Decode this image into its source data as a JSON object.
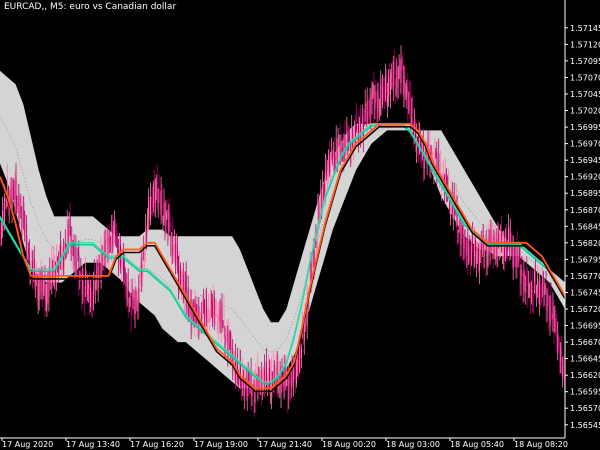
{
  "title": "EURCAD,, M5:  euro vs Canadian dollar",
  "colors": {
    "background": "#000000",
    "axis": "#ffffff",
    "band_fill": "#e6e6e6",
    "band_mid": "#8a8a8a",
    "bull_candle": "#ff7aa8",
    "bear_candle": "#b0006a",
    "orange_line": "#ff5a1a",
    "dark_line": "#1a0500",
    "green_line": "#3dd9a0",
    "teal_line": "#00c8a0"
  },
  "chart_data": {
    "type": "candlestick",
    "title": "EURCAD,, M5:  euro vs Canadian dollar",
    "ylim": [
      1.56525,
      1.57175
    ],
    "y_ticks": [
      "1.57145",
      "1.57120",
      "1.57095",
      "1.57070",
      "1.57045",
      "1.57020",
      "1.56995",
      "1.56970",
      "1.56945",
      "1.56920",
      "1.56895",
      "1.56870",
      "1.56845",
      "1.56820",
      "1.56795",
      "1.56770",
      "1.56745",
      "1.56720",
      "1.56695",
      "1.56670",
      "1.56645",
      "1.56620",
      "1.56595",
      "1.56570",
      "1.56545"
    ],
    "x_ticks": [
      "17 Aug 2020",
      "17 Aug 13:40",
      "17 Aug 16:20",
      "17 Aug 19:00",
      "17 Aug 21:40",
      "18 Aug 00:20",
      "18 Aug 03:00",
      "18 Aug 05:40",
      "18 Aug 08:20"
    ],
    "grid": false,
    "series": [
      {
        "kind": "price",
        "values": [
          1.5683,
          1.569,
          1.5692,
          1.5688,
          1.5679,
          1.5674,
          1.5672,
          1.5676,
          1.568,
          1.5686,
          1.5681,
          1.5676,
          1.5673,
          1.5676,
          1.568,
          1.5683,
          1.5679,
          1.5675,
          1.5676,
          1.5684,
          1.5688,
          1.5685,
          1.5683,
          1.568,
          1.5677,
          1.5673,
          1.5671,
          1.567,
          1.5669,
          1.5668,
          1.5666,
          1.5664,
          1.5663,
          1.5661,
          1.566,
          1.5659,
          1.566,
          1.5661,
          1.5664,
          1.5669,
          1.5676,
          1.5683,
          1.5689,
          1.5693,
          1.5696,
          1.5699,
          1.5701,
          1.5702,
          1.5703,
          1.5701,
          1.5703,
          1.5706,
          1.5709,
          1.5705,
          1.5699,
          1.5695,
          1.5693,
          1.569,
          1.5688,
          1.5687,
          1.5684,
          1.5683,
          1.5681,
          1.568,
          1.5679,
          1.568,
          1.5682,
          1.5681,
          1.5678,
          1.5676,
          1.5674,
          1.567,
          1.5666,
          1.566
        ]
      },
      {
        "kind": "band_upper",
        "values": [
          1.5708,
          1.5707,
          1.5706,
          1.5703,
          1.5698,
          1.5693,
          1.5689,
          1.5686,
          1.5686,
          1.5686,
          1.5686,
          1.5686,
          1.5686,
          1.5685,
          1.5684,
          1.5683,
          1.5683,
          1.5683,
          1.5683,
          1.5684,
          1.5684,
          1.5684,
          1.5683,
          1.5683,
          1.5683,
          1.5683,
          1.5683,
          1.5683,
          1.5683,
          1.5683,
          1.5683,
          1.5681,
          1.5678,
          1.5675,
          1.5672,
          1.567,
          1.567,
          1.5672,
          1.5676,
          1.568,
          1.5684,
          1.5688,
          1.5692,
          1.5695,
          1.5697,
          1.5699,
          1.57,
          1.57,
          1.57,
          1.57,
          1.57,
          1.57,
          1.57,
          1.57,
          1.5699,
          1.5699,
          1.5699,
          1.5699,
          1.5697,
          1.5695,
          1.5693,
          1.5691,
          1.5689,
          1.5687,
          1.5685,
          1.5683,
          1.5682,
          1.5682,
          1.5681,
          1.568,
          1.5679,
          1.5678,
          1.5677,
          1.5676
        ]
      },
      {
        "kind": "band_lower",
        "values": [
          1.5694,
          1.5691,
          1.5687,
          1.5682,
          1.5678,
          1.5677,
          1.5676,
          1.5676,
          1.5676,
          1.5677,
          1.5678,
          1.5679,
          1.5679,
          1.5679,
          1.5678,
          1.5677,
          1.5676,
          1.5674,
          1.5673,
          1.5672,
          1.5671,
          1.5669,
          1.5668,
          1.5667,
          1.5667,
          1.5666,
          1.5665,
          1.5664,
          1.5663,
          1.5662,
          1.5661,
          1.566,
          1.566,
          1.566,
          1.566,
          1.5661,
          1.5662,
          1.5663,
          1.5665,
          1.5668,
          1.5672,
          1.5676,
          1.568,
          1.5684,
          1.5687,
          1.569,
          1.5693,
          1.5695,
          1.5697,
          1.5698,
          1.5699,
          1.5699,
          1.5699,
          1.5699,
          1.5698,
          1.5695,
          1.5692,
          1.5689,
          1.5687,
          1.5685,
          1.5683,
          1.5682,
          1.5681,
          1.5681,
          1.568,
          1.568,
          1.568,
          1.568,
          1.5679,
          1.5678,
          1.5677,
          1.5676,
          1.5674,
          1.5672
        ]
      },
      {
        "kind": "orange_line",
        "values": [
          1.5692,
          1.5689,
          1.5685,
          1.568,
          1.5677,
          1.5677,
          1.5677,
          1.5677,
          1.5677,
          1.5677,
          1.5677,
          1.5677,
          1.5677,
          1.5677,
          1.5677,
          1.568,
          1.5681,
          1.5681,
          1.5681,
          1.5682,
          1.5682,
          1.568,
          1.5678,
          1.5676,
          1.5674,
          1.5672,
          1.567,
          1.5668,
          1.5666,
          1.5665,
          1.5664,
          1.5662,
          1.5661,
          1.566,
          1.566,
          1.566,
          1.5661,
          1.5662,
          1.5664,
          1.5669,
          1.5675,
          1.568,
          1.5685,
          1.5689,
          1.5693,
          1.5695,
          1.5697,
          1.5698,
          1.5699,
          1.57,
          1.57,
          1.57,
          1.57,
          1.57,
          1.5699,
          1.5697,
          1.5694,
          1.5692,
          1.569,
          1.5688,
          1.5686,
          1.5684,
          1.5683,
          1.5682,
          1.5682,
          1.5682,
          1.5682,
          1.5682,
          1.5682,
          1.5681,
          1.568,
          1.5678,
          1.5676,
          1.5674
        ]
      },
      {
        "kind": "green_line",
        "values": [
          1.5686,
          1.5684,
          1.5682,
          1.568,
          1.5678,
          1.5678,
          1.5678,
          1.5678,
          1.568,
          1.5682,
          1.5682,
          1.5682,
          1.5682,
          1.5681,
          1.568,
          1.568,
          1.568,
          1.5679,
          1.5678,
          1.5678,
          1.5677,
          1.5676,
          1.5675,
          1.5673,
          1.5671,
          1.567,
          1.5669,
          1.5668,
          1.5667,
          1.5666,
          1.5665,
          1.5664,
          1.5663,
          1.5662,
          1.5661,
          1.5661,
          1.5662,
          1.5664,
          1.5668,
          1.5673,
          1.5679,
          1.5684,
          1.5689,
          1.5692,
          1.5695,
          1.5697,
          1.5698,
          1.5699,
          1.57,
          1.57,
          1.57,
          1.57,
          1.57,
          1.5699,
          1.5697,
          1.5695,
          1.5693,
          1.5691,
          1.5689,
          1.5687,
          1.5685,
          1.5684,
          1.5683,
          1.5682,
          1.5682,
          1.5682,
          1.5682,
          1.5682,
          1.5681,
          1.568,
          1.5679,
          1.5678,
          1.5676,
          1.5674
        ]
      }
    ]
  }
}
